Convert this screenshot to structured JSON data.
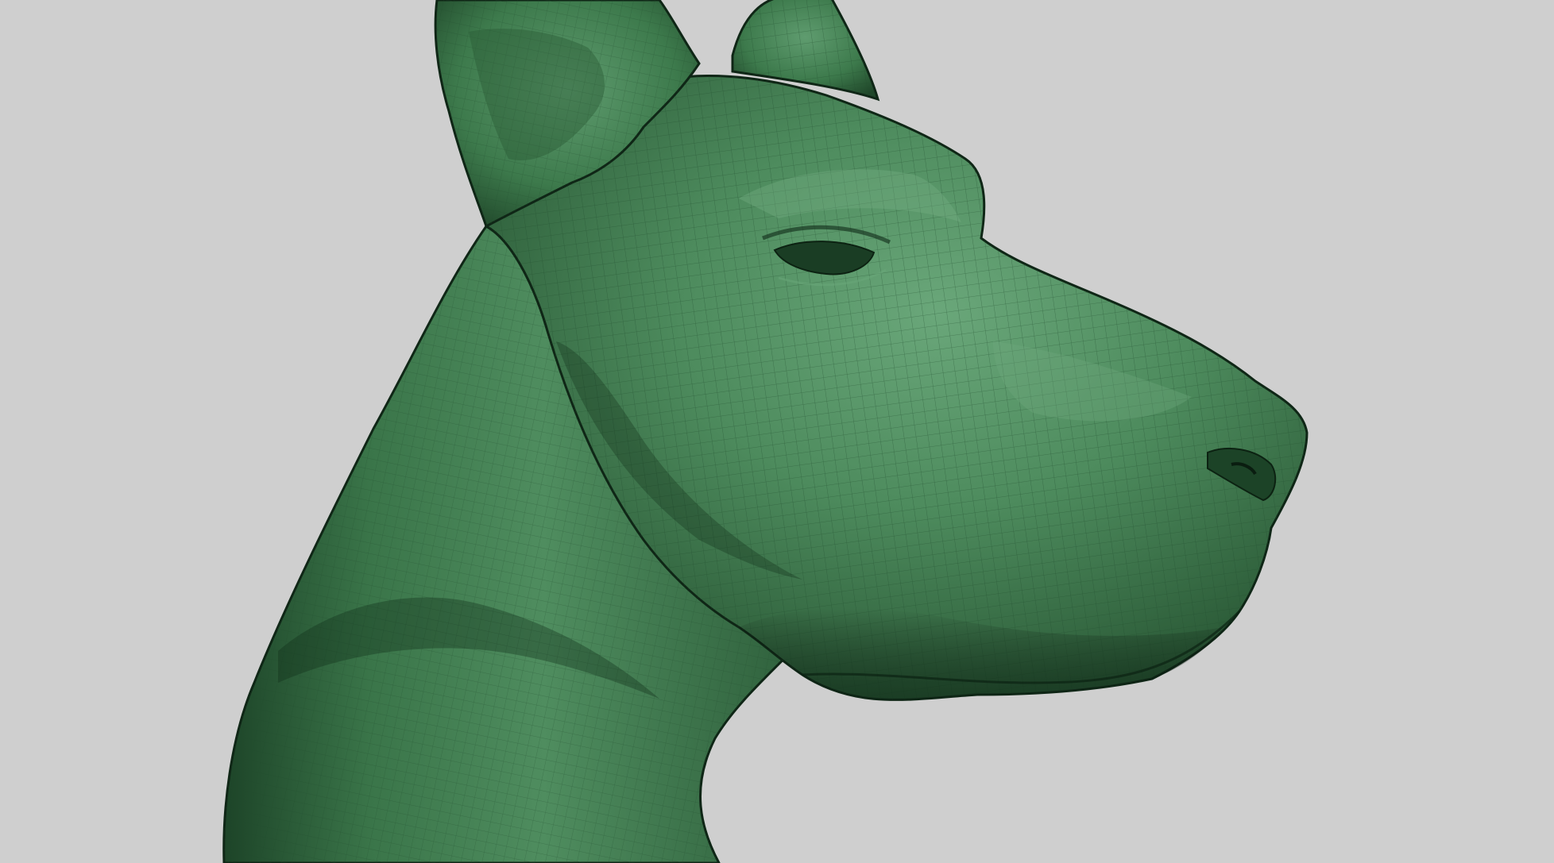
{
  "scene": {
    "background_color": "#cfcfcf",
    "subject": "dog-head-sculpt",
    "material": {
      "base_color": "#3f7d4f",
      "highlight_color": "#6aa77a",
      "shadow_color": "#173a22",
      "wire_color": "#1f4a2c"
    }
  }
}
